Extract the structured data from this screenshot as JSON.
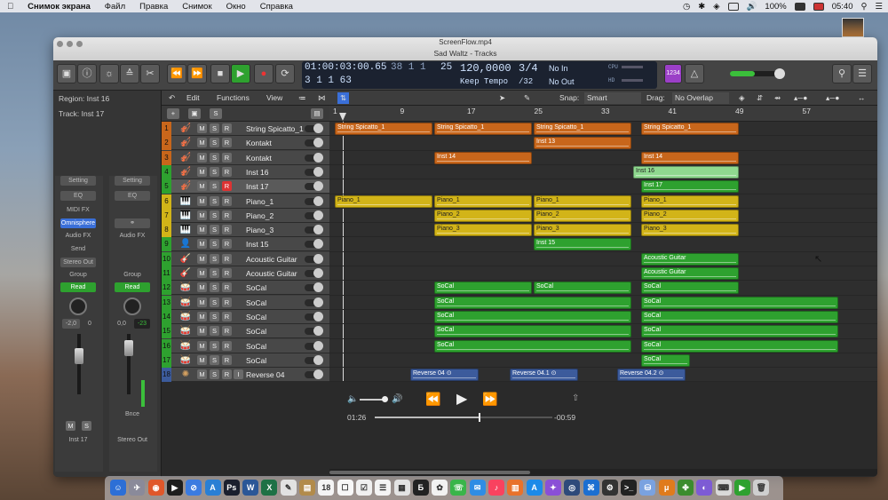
{
  "menubar": {
    "app": "Снимок экрана",
    "items": [
      "Файл",
      "Правка",
      "Снимок",
      "Окно",
      "Справка"
    ],
    "battery": "100%",
    "time": "05:40"
  },
  "window": {
    "file": "ScreenFlow.mp4",
    "title": "Sad Waltz - Tracks"
  },
  "transport": {
    "position_top": "01:00:03:00.65",
    "position_bottom": "3  1  1    63",
    "bars_top": "38  1  1",
    "bars_right": "25",
    "tempo": "120,0000",
    "tempo_mode": "Keep Tempo",
    "time_sig": "3/4",
    "division": "/32",
    "in": "No In",
    "out": "No Out",
    "cpu": "CPU",
    "hd": "HD",
    "count": "1234"
  },
  "inspector": {
    "region": "Region: Inst 16",
    "track": "Track: Inst 17",
    "left": {
      "setting": "Setting",
      "eq": "EQ",
      "midifx": "MIDI FX",
      "instrument": "Omnisphere",
      "audiofx": "Audio FX",
      "send": "Send",
      "output": "Stereo Out",
      "group": "Group",
      "mode": "Read",
      "pan": "-2,0",
      "vol": "0",
      "mute": "M",
      "solo": "S",
      "name": "Inst 17"
    },
    "right": {
      "setting": "Setting",
      "eq": "EQ",
      "group": "Group",
      "mode": "Read",
      "pan": "0,0",
      "vol": "-23",
      "bnce": "Bnce",
      "name": "Stereo Out"
    }
  },
  "toolbar": {
    "edit": "Edit",
    "functions": "Functions",
    "view": "View",
    "snap_label": "Snap:",
    "snap": "Smart",
    "drag_label": "Drag:",
    "drag": "No Overlap"
  },
  "ruler": [
    "1",
    "9",
    "17",
    "25",
    "33",
    "41",
    "49",
    "57"
  ],
  "tracks": [
    {
      "n": "1",
      "name": "String Spicatto_1",
      "c": "#c8661b",
      "i": "🎻"
    },
    {
      "n": "2",
      "name": "Kontakt",
      "c": "#c8661b",
      "i": "🎻"
    },
    {
      "n": "3",
      "name": "Kontakt",
      "c": "#c8661b",
      "i": "🎻"
    },
    {
      "n": "4",
      "name": "Inst 16",
      "c": "#2ea12f",
      "i": "🎻"
    },
    {
      "n": "5",
      "name": "Inst 17",
      "c": "#2ea12f",
      "i": "🎻"
    },
    {
      "n": "6",
      "name": "Piano_1",
      "c": "#d2b418",
      "i": "🎹"
    },
    {
      "n": "7",
      "name": "Piano_2",
      "c": "#d2b418",
      "i": "🎹"
    },
    {
      "n": "8",
      "name": "Piano_3",
      "c": "#d2b418",
      "i": "🎹"
    },
    {
      "n": "9",
      "name": "Inst 15",
      "c": "#2ea12f",
      "i": "👤"
    },
    {
      "n": "10",
      "name": "Acoustic Guitar",
      "c": "#2ea12f",
      "i": "🎸"
    },
    {
      "n": "11",
      "name": "Acoustic Guitar",
      "c": "#2ea12f",
      "i": "🎸"
    },
    {
      "n": "12",
      "name": "SoCal",
      "c": "#2ea12f",
      "i": "🥁"
    },
    {
      "n": "13",
      "name": "SoCal",
      "c": "#2ea12f",
      "i": "🥁"
    },
    {
      "n": "14",
      "name": "SoCal",
      "c": "#2ea12f",
      "i": "🥁"
    },
    {
      "n": "15",
      "name": "SoCal",
      "c": "#2ea12f",
      "i": "🥁"
    },
    {
      "n": "16",
      "name": "SoCal",
      "c": "#2ea12f",
      "i": "🥁"
    },
    {
      "n": "17",
      "name": "SoCal",
      "c": "#2ea12f",
      "i": "🥁"
    },
    {
      "n": "18",
      "name": "Reverse 04",
      "c": "#3c5b9c",
      "i": "✺"
    }
  ],
  "msr": {
    "m": "M",
    "s": "S",
    "r": "R",
    "i": "I"
  },
  "regions": [
    {
      "t": 0,
      "a": 0,
      "w": 110,
      "cls": "o",
      "label": "String Spicatto_1"
    },
    {
      "t": 0,
      "a": 112,
      "w": 110,
      "cls": "o",
      "label": "String Spicatto_1"
    },
    {
      "t": 0,
      "a": 224,
      "w": 110,
      "cls": "o",
      "label": "String Spicatto_1"
    },
    {
      "t": 0,
      "a": 345,
      "w": 110,
      "cls": "o",
      "label": "String Spicatto_1"
    },
    {
      "t": 1,
      "a": 224,
      "w": 110,
      "cls": "o",
      "label": "Inst 13"
    },
    {
      "t": 2,
      "a": 112,
      "w": 110,
      "cls": "o",
      "label": "Inst 14"
    },
    {
      "t": 2,
      "a": 345,
      "w": 110,
      "cls": "o",
      "label": "Inst 14"
    },
    {
      "t": 3,
      "a": 336,
      "w": 119,
      "cls": "lg",
      "label": "Inst 16"
    },
    {
      "t": 4,
      "a": 345,
      "w": 110,
      "cls": "g",
      "label": "Inst 17"
    },
    {
      "t": 5,
      "a": 0,
      "w": 110,
      "cls": "y",
      "label": "Piano_1"
    },
    {
      "t": 5,
      "a": 112,
      "w": 110,
      "cls": "y",
      "label": "Piano_1"
    },
    {
      "t": 5,
      "a": 224,
      "w": 110,
      "cls": "y",
      "label": "Piano_1"
    },
    {
      "t": 5,
      "a": 345,
      "w": 110,
      "cls": "y",
      "label": "Piano_1"
    },
    {
      "t": 6,
      "a": 112,
      "w": 110,
      "cls": "y",
      "label": "Piano_2"
    },
    {
      "t": 6,
      "a": 224,
      "w": 110,
      "cls": "y",
      "label": "Piano_2"
    },
    {
      "t": 6,
      "a": 345,
      "w": 110,
      "cls": "y",
      "label": "Piano_2"
    },
    {
      "t": 7,
      "a": 112,
      "w": 110,
      "cls": "y",
      "label": "Piano_3"
    },
    {
      "t": 7,
      "a": 224,
      "w": 110,
      "cls": "y",
      "label": "Piano_3"
    },
    {
      "t": 7,
      "a": 345,
      "w": 110,
      "cls": "y",
      "label": "Piano_3"
    },
    {
      "t": 8,
      "a": 224,
      "w": 110,
      "cls": "g",
      "label": "Inst 15"
    },
    {
      "t": 9,
      "a": 345,
      "w": 110,
      "cls": "g",
      "label": "Acoustic Guitar"
    },
    {
      "t": 10,
      "a": 345,
      "w": 110,
      "cls": "g",
      "label": "Acoustic Guitar"
    },
    {
      "t": 11,
      "a": 112,
      "w": 110,
      "cls": "g",
      "label": "SoCal"
    },
    {
      "t": 11,
      "a": 224,
      "w": 110,
      "cls": "g",
      "label": "SoCal"
    },
    {
      "t": 11,
      "a": 345,
      "w": 110,
      "cls": "g",
      "label": "SoCal"
    },
    {
      "t": 12,
      "a": 112,
      "w": 222,
      "cls": "g",
      "label": "SoCal"
    },
    {
      "t": 12,
      "a": 345,
      "w": 222,
      "cls": "g",
      "label": "SoCal"
    },
    {
      "t": 13,
      "a": 112,
      "w": 222,
      "cls": "g",
      "label": "SoCal"
    },
    {
      "t": 13,
      "a": 345,
      "w": 222,
      "cls": "g",
      "label": "SoCal"
    },
    {
      "t": 14,
      "a": 112,
      "w": 222,
      "cls": "g",
      "label": "SoCal"
    },
    {
      "t": 14,
      "a": 345,
      "w": 222,
      "cls": "g",
      "label": "SoCal"
    },
    {
      "t": 15,
      "a": 112,
      "w": 222,
      "cls": "g",
      "label": "SoCal"
    },
    {
      "t": 15,
      "a": 345,
      "w": 222,
      "cls": "g",
      "label": "SoCal"
    },
    {
      "t": 16,
      "a": 345,
      "w": 55,
      "cls": "g",
      "label": "SoCal"
    },
    {
      "t": 17,
      "a": 85,
      "w": 77,
      "cls": "b",
      "label": "Reverse 04  ⊙"
    },
    {
      "t": 17,
      "a": 197,
      "w": 77,
      "cls": "b",
      "label": "Reverse 04.1  ⊙"
    },
    {
      "t": 17,
      "a": 318,
      "w": 77,
      "cls": "b",
      "label": "Reverse 04.2  ⊙"
    }
  ],
  "player": {
    "elapsed": "01:26",
    "remaining": "-00:59"
  },
  "dock": [
    {
      "c": "#2d6fd6",
      "i": "☺"
    },
    {
      "c": "#8a8a9a",
      "i": "✈"
    },
    {
      "c": "#e0572a",
      "i": "◉"
    },
    {
      "c": "#1d1d1d",
      "i": "▶"
    },
    {
      "c": "#3b7be0",
      "i": "⊘"
    },
    {
      "c": "#2a7fd4",
      "i": "A"
    },
    {
      "c": "#1b1f2e",
      "i": "Ps"
    },
    {
      "c": "#2b5797",
      "i": "W"
    },
    {
      "c": "#1e7145",
      "i": "X"
    },
    {
      "c": "#e2e2e2",
      "i": "✎"
    },
    {
      "c": "#b28b4b",
      "i": "▤"
    },
    {
      "c": "#f4f4f4",
      "i": "18"
    },
    {
      "c": "#f7f7f7",
      "i": "☐"
    },
    {
      "c": "#f0f0f0",
      "i": "☑"
    },
    {
      "c": "#f4f4f4",
      "i": "☰"
    },
    {
      "c": "#e3e3e3",
      "i": "▦"
    },
    {
      "c": "#222",
      "i": "Б"
    },
    {
      "c": "#f2f2f2",
      "i": "✿"
    },
    {
      "c": "#39b54a",
      "i": "☏"
    },
    {
      "c": "#2f8de4",
      "i": "✉"
    },
    {
      "c": "#f9425f",
      "i": "♪"
    },
    {
      "c": "#e8722b",
      "i": "▥"
    },
    {
      "c": "#1c8ae8",
      "i": "A"
    },
    {
      "c": "#8a4fd6",
      "i": "✦"
    },
    {
      "c": "#2e4a7a",
      "i": "◎"
    },
    {
      "c": "#1c6fd1",
      "i": "⌘"
    },
    {
      "c": "#333",
      "i": "⚙"
    },
    {
      "c": "#222",
      "i": ">_"
    },
    {
      "c": "#7aa2e0",
      "i": "⛁"
    },
    {
      "c": "#e07b1c",
      "i": "μ"
    },
    {
      "c": "#3b8c2e",
      "i": "✤"
    },
    {
      "c": "#7d5bd4",
      "i": "◐"
    },
    {
      "c": "#d9d9d9",
      "i": "⌨"
    },
    {
      "c": "#2ea12f",
      "i": "▶"
    },
    {
      "c": "#cfcfcf",
      "i": "🗑"
    }
  ]
}
